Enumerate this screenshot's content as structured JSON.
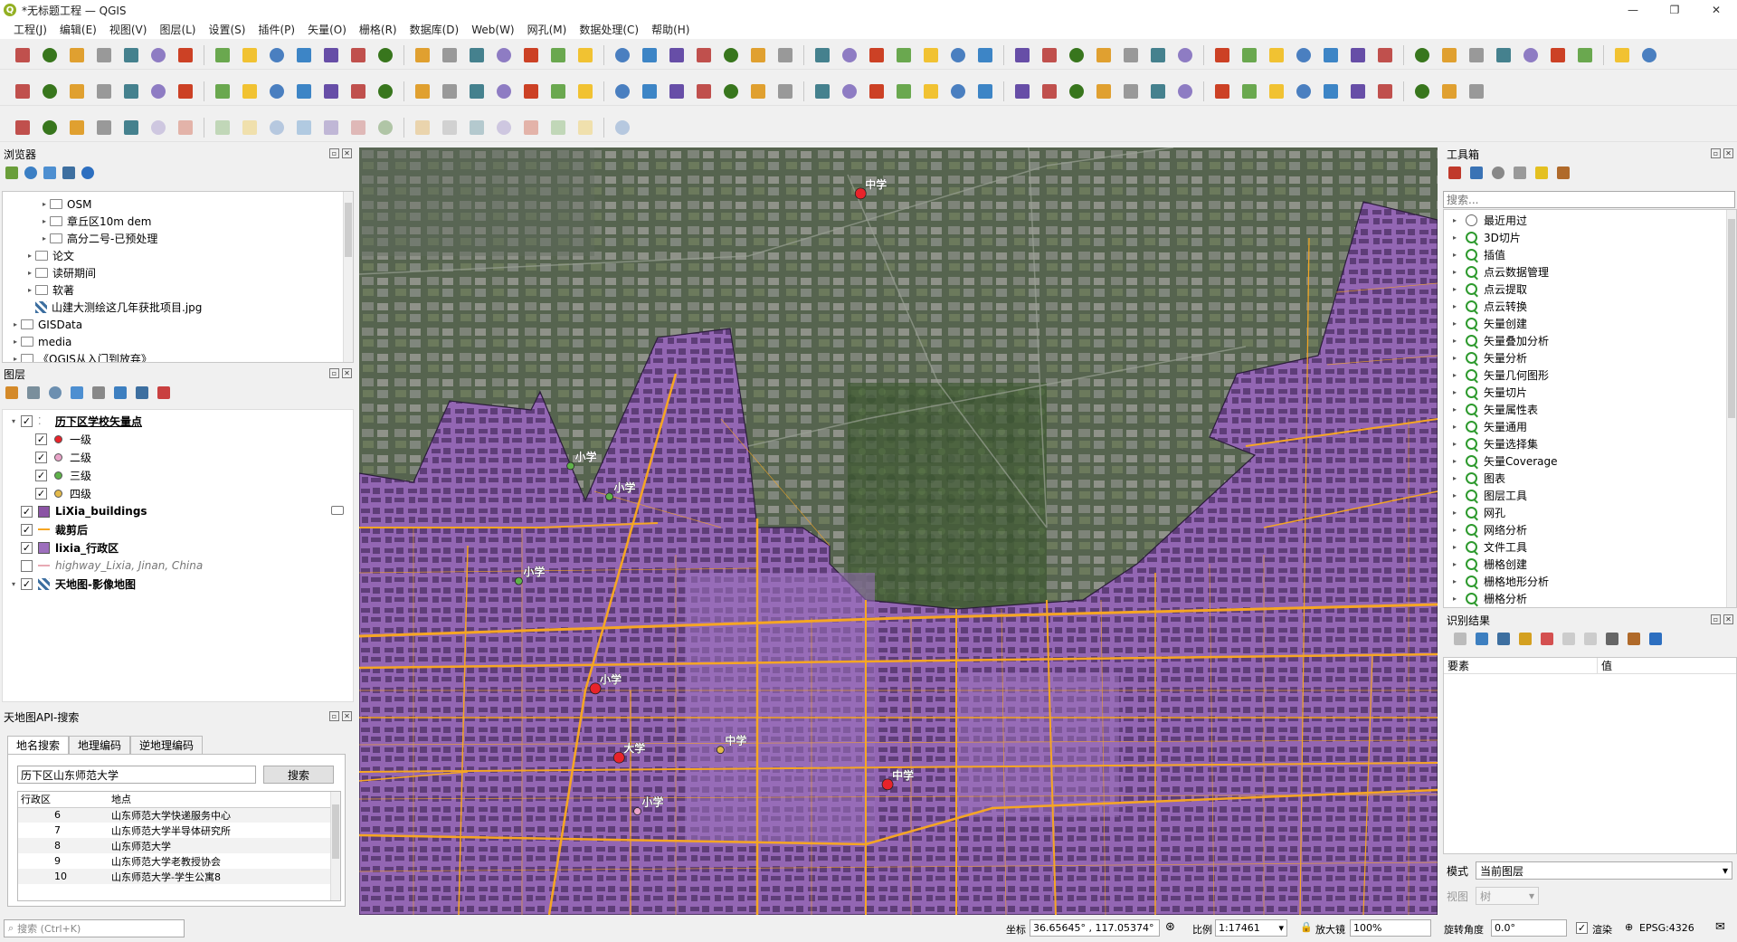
{
  "window": {
    "title": "*无标题工程 — QGIS",
    "logo": "Q"
  },
  "menu": [
    "工程(J)",
    "编辑(E)",
    "视图(V)",
    "图层(L)",
    "设置(S)",
    "插件(P)",
    "矢量(O)",
    "栅格(R)",
    "数据库(D)",
    "Web(W)",
    "网孔(M)",
    "数据处理(C)",
    "帮助(H)"
  ],
  "browser": {
    "title": "浏览器",
    "items": [
      {
        "label": "OSM",
        "indent": 3,
        "expand": true,
        "icon": "folder"
      },
      {
        "label": "章丘区10m dem",
        "indent": 3,
        "expand": true,
        "icon": "folder"
      },
      {
        "label": "高分二号-已预处理",
        "indent": 3,
        "expand": true,
        "icon": "folder"
      },
      {
        "label": "论文",
        "indent": 2,
        "expand": true,
        "icon": "folder"
      },
      {
        "label": "读研期间",
        "indent": 2,
        "expand": true,
        "icon": "folder"
      },
      {
        "label": "软著",
        "indent": 2,
        "expand": true,
        "icon": "folder"
      },
      {
        "label": "山建大测绘这几年获批项目.jpg",
        "indent": 2,
        "expand": false,
        "icon": "raster"
      },
      {
        "label": "GISData",
        "indent": 1,
        "expand": true,
        "icon": "folder"
      },
      {
        "label": "media",
        "indent": 1,
        "expand": true,
        "icon": "folder"
      },
      {
        "label": "《QGIS从入门到放弃》",
        "indent": 1,
        "expand": true,
        "icon": "folder"
      }
    ]
  },
  "layers": {
    "title": "图层",
    "items": [
      {
        "label": "历下区学校矢量点",
        "level": 0,
        "checked": true,
        "style": "bold-underline",
        "sym": "points"
      },
      {
        "label": "一级",
        "level": 1,
        "checked": true,
        "sym": "dot",
        "color": "#e8232a"
      },
      {
        "label": "二级",
        "level": 1,
        "checked": true,
        "sym": "dot",
        "color": "#e9a3c8"
      },
      {
        "label": "三级",
        "level": 1,
        "checked": true,
        "sym": "dot",
        "color": "#5fb24a"
      },
      {
        "label": "四级",
        "level": 1,
        "checked": true,
        "sym": "dot",
        "color": "#e3b94a"
      },
      {
        "label": "LiXia_buildings",
        "level": 0,
        "checked": true,
        "style": "bold",
        "sym": "fill",
        "color": "#8b54a4"
      },
      {
        "label": "裁剪后",
        "level": 0,
        "checked": true,
        "style": "bold",
        "sym": "line",
        "color": "#f5a623"
      },
      {
        "label": "lixia_行政区",
        "level": 0,
        "checked": true,
        "style": "bold",
        "sym": "fill",
        "color": "#9d6fbd"
      },
      {
        "label": "highway_Lixia, Jinan, China",
        "level": 0,
        "checked": false,
        "style": "italic",
        "sym": "line",
        "color": "#e8a9b4"
      },
      {
        "label": "天地图-影像地图",
        "level": 0,
        "checked": true,
        "style": "bold",
        "sym": "raster"
      }
    ]
  },
  "search": {
    "title": "天地图API-搜索",
    "tabs": [
      "地名搜索",
      "地理编码",
      "逆地理编码"
    ],
    "query": "历下区山东师范大学",
    "button": "搜索",
    "columns": [
      "行政区",
      "地点"
    ],
    "rows": [
      [
        "6",
        "山东师范大学快递服务中心"
      ],
      [
        "7",
        "山东师范大学半导体研究所"
      ],
      [
        "8",
        "山东师范大学"
      ],
      [
        "9",
        "山东师范大学老教授协会"
      ],
      [
        "10",
        "山东师范大学-学生公寓8"
      ]
    ]
  },
  "toolbox": {
    "title": "工具箱",
    "search_placeholder": "搜索...",
    "items": [
      "最近用过",
      "3D切片",
      "插值",
      "点云数据管理",
      "点云提取",
      "点云转换",
      "矢量创建",
      "矢量叠加分析",
      "矢量分析",
      "矢量几何图形",
      "矢量切片",
      "矢量属性表",
      "矢量通用",
      "矢量选择集",
      "矢量Coverage",
      "图表",
      "图层工具",
      "网孔",
      "网络分析",
      "文件工具",
      "栅格创建",
      "栅格地形分析",
      "栅格分析"
    ]
  },
  "identify": {
    "title": "识别结果",
    "col_feature": "要素",
    "col_value": "值",
    "mode_label": "模式",
    "mode_value": "当前图层",
    "view_label": "视图",
    "view_value": "树"
  },
  "map_labels": [
    {
      "text": "中学",
      "cat": "一级",
      "lon": 0.465,
      "lat": 0.06
    },
    {
      "text": "小学",
      "cat": "三级",
      "lon": 0.196,
      "lat": 0.415
    },
    {
      "text": "小学",
      "cat": "三级",
      "lon": 0.232,
      "lat": 0.455
    },
    {
      "text": "小学",
      "cat": "三级",
      "lon": 0.148,
      "lat": 0.565
    },
    {
      "text": "小学",
      "cat": "一级",
      "lon": 0.219,
      "lat": 0.705
    },
    {
      "text": "大学",
      "cat": "一级",
      "lon": 0.241,
      "lat": 0.795
    },
    {
      "text": "中学",
      "cat": "四级",
      "lon": 0.335,
      "lat": 0.785
    },
    {
      "text": "中学",
      "cat": "一级",
      "lon": 0.49,
      "lat": 0.83
    },
    {
      "text": "小学",
      "cat": "二级",
      "lon": 0.258,
      "lat": 0.865
    }
  ],
  "status": {
    "search_placeholder": "搜索 (Ctrl+K)",
    "coord_label": "坐标",
    "coord_value": "36.65645° , 117.05374°",
    "scale_label": "比例",
    "scale_value": "1:17461",
    "mag_label": "放大镜",
    "mag_value": "100%",
    "rot_label": "旋转角度",
    "rot_value": "0.0°",
    "render_label": "渲染",
    "crs": "EPSG:4326"
  }
}
